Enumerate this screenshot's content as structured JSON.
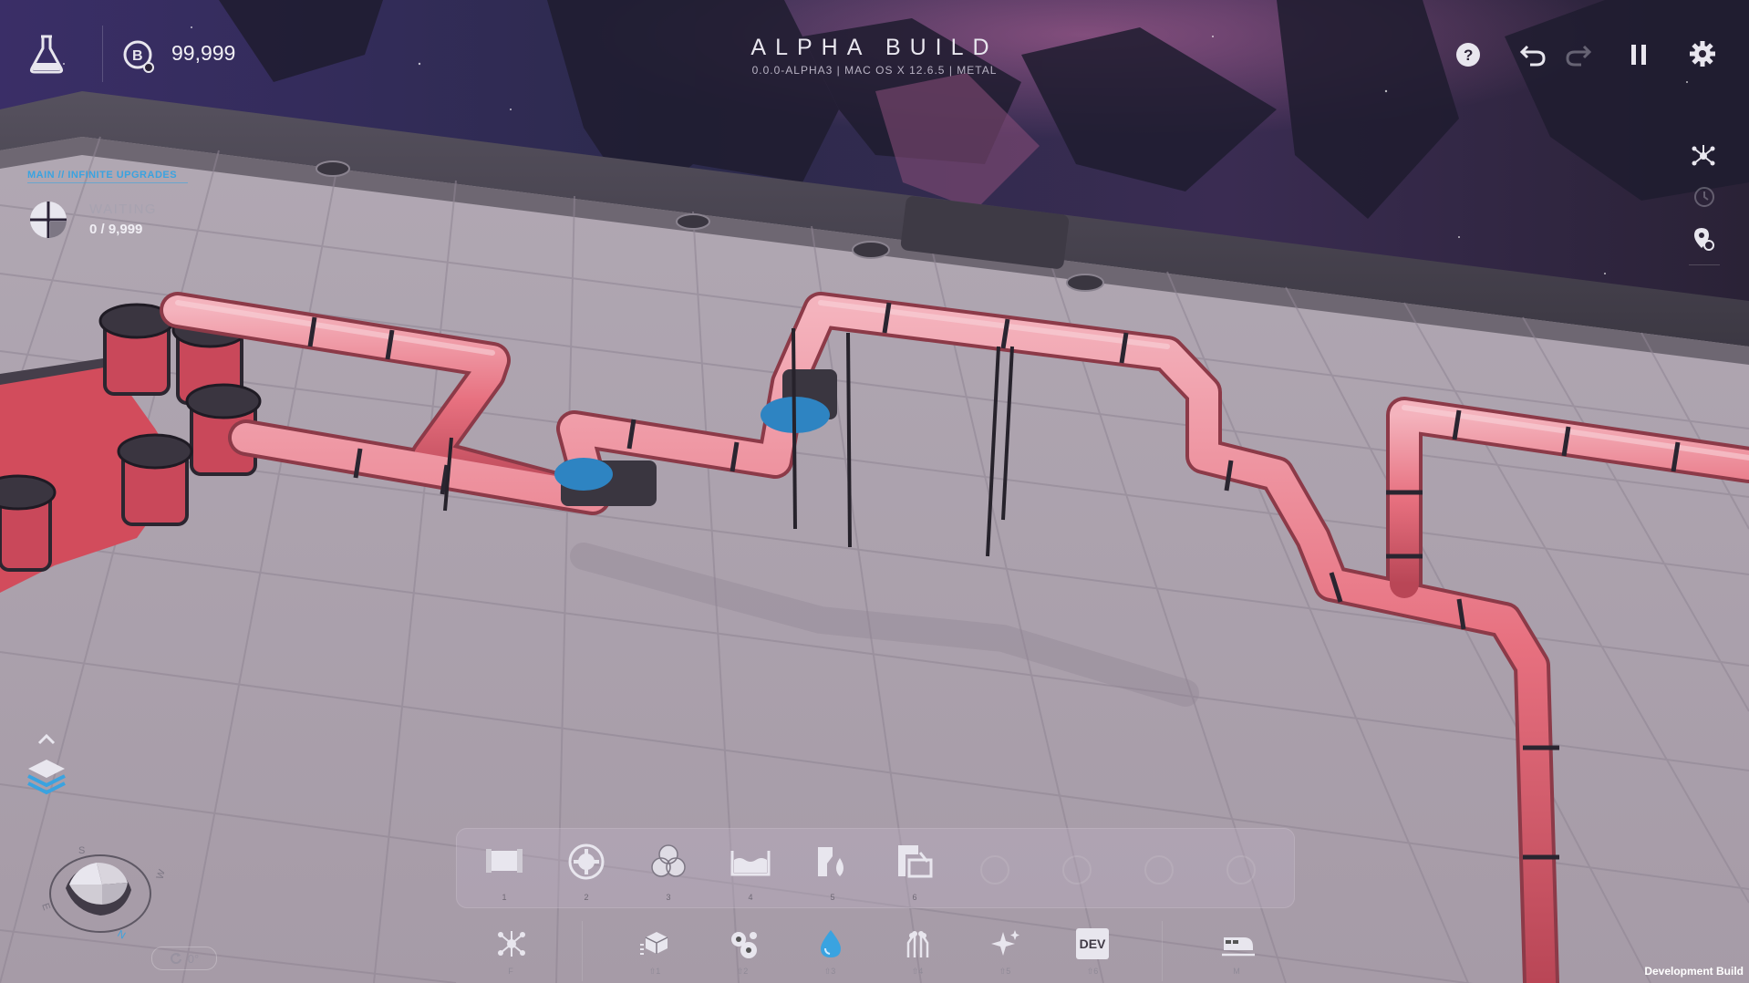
{
  "header": {
    "title": "ALPHA BUILD",
    "subtitle": "0.0.0-ALPHA3 | MAC OS X 12.6.5 | METAL"
  },
  "currency": {
    "icon": "coin-b-icon",
    "amount": "99,999"
  },
  "objective": {
    "breadcrumb": "MAIN // INFINITE UPGRADES",
    "status": "WAITING",
    "progress": "0 / 9,999"
  },
  "top_right_buttons": [
    "help-icon",
    "undo-icon",
    "redo-icon",
    "pause-icon",
    "settings-icon"
  ],
  "side_buttons": [
    "network-icon",
    "history-icon",
    "waypoint-icon"
  ],
  "toolbar": {
    "slots": [
      {
        "icon": "pipe-icon",
        "key": "1"
      },
      {
        "icon": "pump-icon",
        "key": "2"
      },
      {
        "icon": "mixer-icon",
        "key": "3"
      },
      {
        "icon": "tank-icon",
        "key": "4"
      },
      {
        "icon": "fluid-extractor-icon",
        "key": "5"
      },
      {
        "icon": "fluid-output-icon",
        "key": "6"
      }
    ]
  },
  "categories": [
    {
      "icon": "network-icon",
      "key": "F"
    },
    {
      "icon": "blocks-icon",
      "key": "⇧1"
    },
    {
      "icon": "gears-icon",
      "key": "⇧2"
    },
    {
      "icon": "fluid-drop-icon",
      "key": "⇧3",
      "active": true
    },
    {
      "icon": "wires-icon",
      "key": "⇧4"
    },
    {
      "icon": "sparkle-icon",
      "key": "⇧5"
    },
    {
      "icon": "dev-icon",
      "key": "⇧6",
      "label": "DEV"
    },
    {
      "icon": "train-icon",
      "key": "M"
    }
  ],
  "compass": {
    "rotation_label": "0°",
    "letters": [
      "S",
      "E",
      "N",
      "W"
    ]
  },
  "footer": {
    "build_label": "Development Build"
  },
  "colors": {
    "accent": "#3aa3e0",
    "pipe": "#e8778a",
    "fluid": "#d9505e",
    "floor": "#a39aa4"
  }
}
